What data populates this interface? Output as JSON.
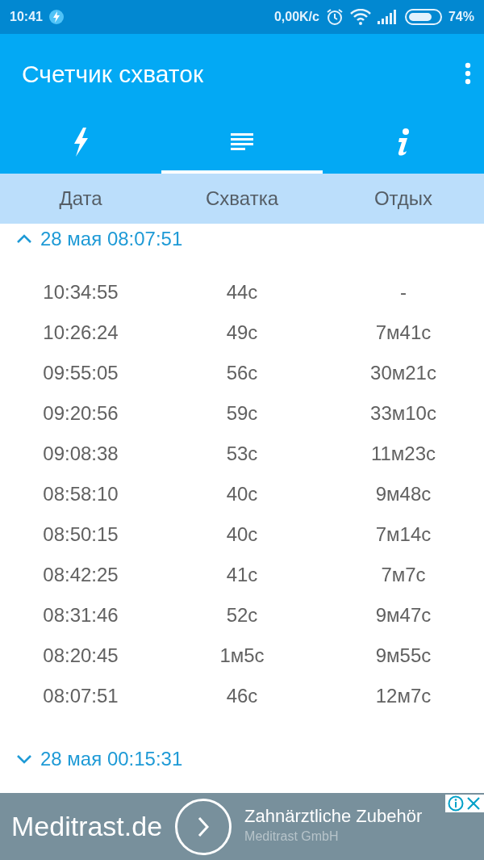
{
  "status_bar": {
    "time": "10:41",
    "speed": "0,00K/c",
    "battery": "74%"
  },
  "app_bar": {
    "title": "Счетчик схваток"
  },
  "tabs": [
    {
      "kind": "bolt",
      "selected": false
    },
    {
      "kind": "list",
      "selected": true
    },
    {
      "kind": "info",
      "selected": false
    }
  ],
  "table": {
    "columns": [
      "Дата",
      "Схватка",
      "Отдых"
    ],
    "groups": [
      {
        "title": "28 мая 08:07:51",
        "expanded": true,
        "rows": [
          [
            "10:34:55",
            "44с",
            "-"
          ],
          [
            "10:26:24",
            "49с",
            "7м41с"
          ],
          [
            "09:55:05",
            "56с",
            "30м21с"
          ],
          [
            "09:20:56",
            "59с",
            "33м10с"
          ],
          [
            "09:08:38",
            "53с",
            "11м23с"
          ],
          [
            "08:58:10",
            "40с",
            "9м48с"
          ],
          [
            "08:50:15",
            "40с",
            "7м14с"
          ],
          [
            "08:42:25",
            "41с",
            "7м7с"
          ],
          [
            "08:31:46",
            "52с",
            "9м47с"
          ],
          [
            "08:20:45",
            "1м5с",
            "9м55с"
          ],
          [
            "08:07:51",
            "46с",
            "12м7с"
          ]
        ]
      },
      {
        "title": "28 мая 00:15:31",
        "expanded": false
      }
    ]
  },
  "ad": {
    "brand": "Meditrast.de",
    "headline": "Zahnärztliche Zubehör",
    "advertiser": "Meditrast GmbH"
  }
}
